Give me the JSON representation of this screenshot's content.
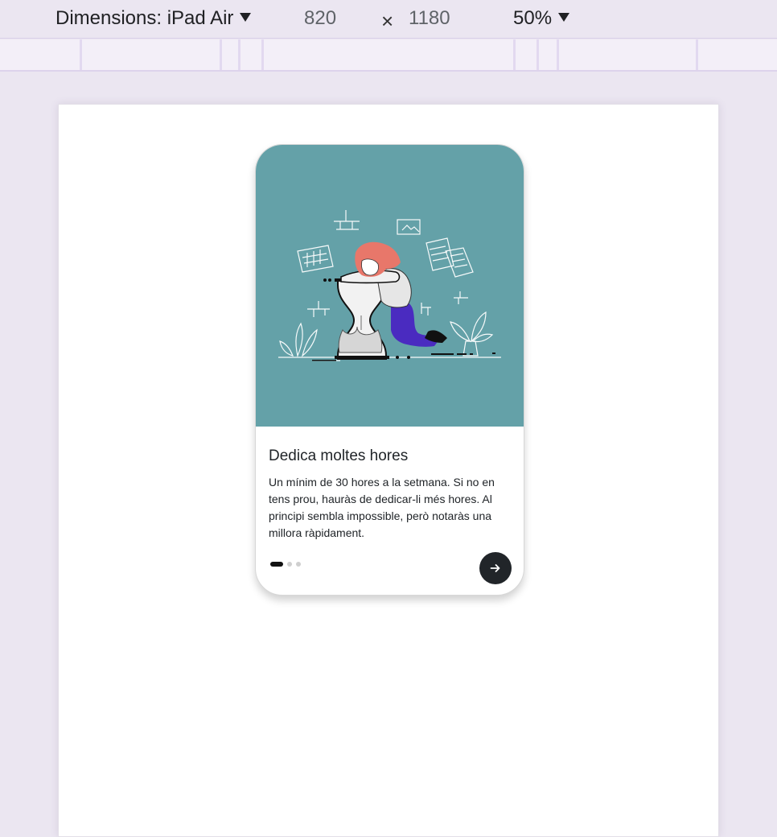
{
  "devtools": {
    "device_label": "Dimensions: iPad Air",
    "width": "820",
    "times": "×",
    "height": "1180",
    "zoom": "50%"
  },
  "card": {
    "title": "Dedica moltes hores",
    "text": "Un mínim de 30 hores a la setmana. Si no en tens prou, hauràs de dedicar-li més hores. Al principi sembla impossible, però notaràs una millora ràpidament.",
    "pagination": {
      "total": 3,
      "active": 1
    },
    "next_icon": "arrow-right-icon"
  },
  "colors": {
    "hero_bg": "#64a1a8",
    "button_bg": "#212529",
    "hair": "#e8776a",
    "pants": "#4a2bc0"
  },
  "illustration": "hourglass-person-icon"
}
